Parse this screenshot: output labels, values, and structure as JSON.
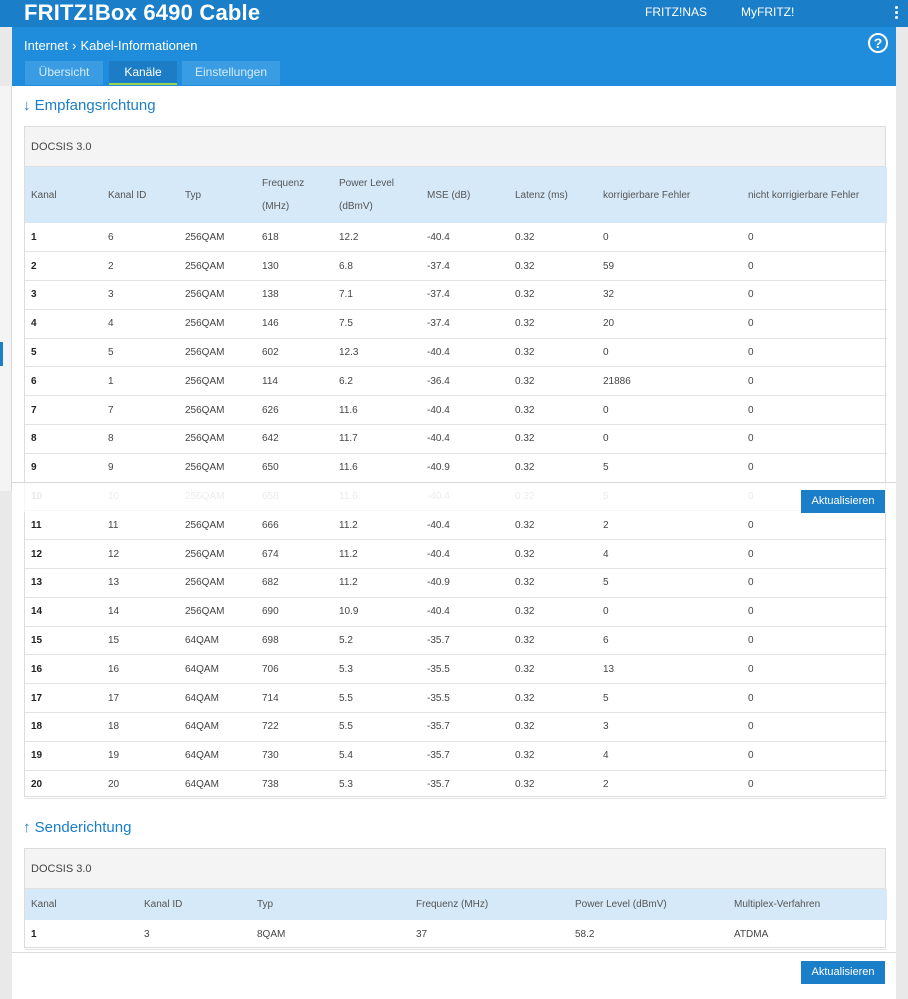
{
  "topbar": {
    "brand": "FRITZ!Box 6490 Cable",
    "links": [
      "FRITZ!NAS",
      "MyFRITZ!"
    ]
  },
  "header": {
    "breadcrumb": [
      "Internet",
      "Kabel-Informationen"
    ],
    "breadcrumb_sep": "›",
    "help_glyph": "?",
    "tabs": [
      "Übersicht",
      "Kanäle",
      "Einstellungen"
    ],
    "active_tab": "Kanäle"
  },
  "downstream": {
    "title_arrow": "↓",
    "title": "Empfangsrichtung",
    "caption": "DOCSIS 3.0",
    "columns": [
      "Kanal",
      "Kanal ID",
      "Typ",
      "Frequenz",
      "(MHz)",
      "Power Level",
      "(dBmV)",
      "MSE (dB)",
      "Latenz (ms)",
      "korrigierbare Fehler",
      "nicht korrigierbare Fehler"
    ],
    "rows": [
      [
        "1",
        "6",
        "256QAM",
        "618",
        "12.2",
        "-40.4",
        "0.32",
        "0",
        "0"
      ],
      [
        "2",
        "2",
        "256QAM",
        "130",
        "6.8",
        "-37.4",
        "0.32",
        "59",
        "0"
      ],
      [
        "3",
        "3",
        "256QAM",
        "138",
        "7.1",
        "-37.4",
        "0.32",
        "32",
        "0"
      ],
      [
        "4",
        "4",
        "256QAM",
        "146",
        "7.5",
        "-37.4",
        "0.32",
        "20",
        "0"
      ],
      [
        "5",
        "5",
        "256QAM",
        "602",
        "12.3",
        "-40.4",
        "0.32",
        "0",
        "0"
      ],
      [
        "6",
        "1",
        "256QAM",
        "114",
        "6.2",
        "-36.4",
        "0.32",
        "21886",
        "0"
      ],
      [
        "7",
        "7",
        "256QAM",
        "626",
        "11.6",
        "-40.4",
        "0.32",
        "0",
        "0"
      ],
      [
        "8",
        "8",
        "256QAM",
        "642",
        "11.7",
        "-40.4",
        "0.32",
        "0",
        "0"
      ],
      [
        "9",
        "9",
        "256QAM",
        "650",
        "11.6",
        "-40.9",
        "0.32",
        "5",
        "0"
      ],
      [
        "10",
        "10",
        "256QAM",
        "658",
        "11.6",
        "-40.4",
        "0.32",
        "5",
        "0"
      ],
      [
        "11",
        "11",
        "256QAM",
        "666",
        "11.2",
        "-40.4",
        "0.32",
        "2",
        "0"
      ],
      [
        "12",
        "12",
        "256QAM",
        "674",
        "11.2",
        "-40.4",
        "0.32",
        "4",
        "0"
      ],
      [
        "13",
        "13",
        "256QAM",
        "682",
        "11.2",
        "-40.9",
        "0.32",
        "5",
        "0"
      ],
      [
        "14",
        "14",
        "256QAM",
        "690",
        "10.9",
        "-40.4",
        "0.32",
        "0",
        "0"
      ],
      [
        "15",
        "15",
        "64QAM",
        "698",
        "5.2",
        "-35.7",
        "0.32",
        "6",
        "0"
      ],
      [
        "16",
        "16",
        "64QAM",
        "706",
        "5.3",
        "-35.5",
        "0.32",
        "13",
        "0"
      ],
      [
        "17",
        "17",
        "64QAM",
        "714",
        "5.5",
        "-35.5",
        "0.32",
        "5",
        "0"
      ],
      [
        "18",
        "18",
        "64QAM",
        "722",
        "5.5",
        "-35.7",
        "0.32",
        "3",
        "0"
      ],
      [
        "19",
        "19",
        "64QAM",
        "730",
        "5.4",
        "-35.7",
        "0.32",
        "4",
        "0"
      ],
      [
        "20",
        "20",
        "64QAM",
        "738",
        "5.3",
        "-35.7",
        "0.32",
        "2",
        "0"
      ]
    ]
  },
  "upstream": {
    "title_arrow": "↑",
    "title": "Senderichtung",
    "caption": "DOCSIS 3.0",
    "columns": [
      "Kanal",
      "Kanal ID",
      "Typ",
      "Frequenz (MHz)",
      "Power Level (dBmV)",
      "Multiplex-Verfahren"
    ],
    "rows": [
      [
        "1",
        "3",
        "8QAM",
        "37",
        "58.2",
        "ATDMA"
      ]
    ]
  },
  "buttons": {
    "refresh": "Aktualisieren"
  },
  "colors": {
    "topbar": "#1a7ec8",
    "header": "#1f8ddc",
    "table_head": "#d6e9f8",
    "tab_indicator": "#9bd34e"
  }
}
